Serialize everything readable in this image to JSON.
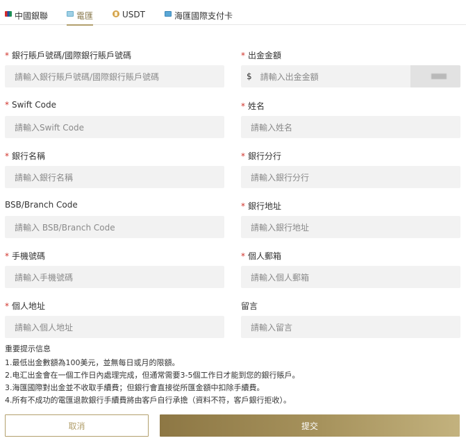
{
  "tabs": [
    {
      "label": "中國銀聯",
      "icon": "unionpay-card-icon",
      "active": false
    },
    {
      "label": "電匯",
      "icon": "wire-card-icon",
      "active": true
    },
    {
      "label": "USDT",
      "icon": "usdt-coin-icon",
      "active": false
    },
    {
      "label": "海匯國際支付卡",
      "icon": "overseas-card-icon",
      "active": false
    }
  ],
  "form": {
    "bank_account": {
      "label": "銀行賬戶號碼/國際銀行賬戶號碼",
      "placeholder": "請輸入銀行賬戶號碼/國際銀行賬戶號碼",
      "required": true
    },
    "amount": {
      "label": "出金金額",
      "placeholder": "請輸入出金金額",
      "currency": "$",
      "required": true
    },
    "swift": {
      "label": "Swift Code",
      "placeholder": "請輸入Swift Code",
      "required": true
    },
    "name": {
      "label": "姓名",
      "placeholder": "請輸入姓名",
      "required": true
    },
    "bank_name": {
      "label": "銀行名稱",
      "placeholder": "請輸入銀行名稱",
      "required": true
    },
    "bank_branch": {
      "label": "銀行分行",
      "placeholder": "請輸入銀行分行",
      "required": true
    },
    "bsb": {
      "label": "BSB/Branch Code",
      "placeholder": "請輸入 BSB/Branch Code",
      "required": false
    },
    "bank_address": {
      "label": "銀行地址",
      "placeholder": "請輸入銀行地址",
      "required": true
    },
    "phone": {
      "label": "手機號碼",
      "placeholder": "請輸入手機號碼",
      "required": true
    },
    "email": {
      "label": "個人郵箱",
      "placeholder": "請輸入個人郵箱",
      "required": true
    },
    "address": {
      "label": "個人地址",
      "placeholder": "請輸入個人地址",
      "required": true
    },
    "message": {
      "label": "留言",
      "placeholder": "請輸入留言",
      "required": false
    }
  },
  "notes": {
    "title": "重要提示信息",
    "items": [
      "1.最低出金數額為100美元，並無每日或月的限額。",
      "2.电汇出金會在一個工作日內處理完成，但通常需要3-5個工作日才能到您的銀行賬戶。",
      "3.海匯國際對出金並不收取手續費；但銀行會直接從所匯金額中扣除手續費。",
      "4.所有不成功的電匯退款銀行手續費將由客戶自行承擔（資料不符，客戶銀行拒收）。"
    ]
  },
  "buttons": {
    "cancel": "取消",
    "submit": "提交"
  },
  "colors": {
    "accent": "#b29f6c",
    "required": "#d0342c",
    "input_bg": "#f2f2f2"
  }
}
